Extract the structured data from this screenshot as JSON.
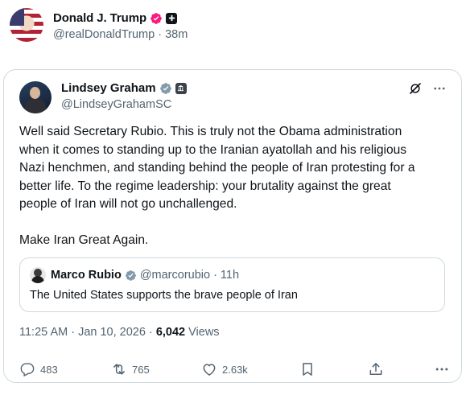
{
  "outer_post": {
    "author_name": "Donald J. Trump",
    "handle": "@realDonaldTrump",
    "separator": "·",
    "time_ago": "38m"
  },
  "quoted_post": {
    "author_name": "Lindsey Graham",
    "handle": "@LindseyGrahamSC",
    "text": "Well said Secretary Rubio. This is truly not the Obama administration\nwhen it comes to standing up to the Iranian ayatollah and his religious\nNazi henchmen, and standing behind the people of Iran protesting for a\nbetter life. To the regime leadership: your brutality against the great\npeople of Iran will not go unchallenged.\n\nMake Iran Great Again.",
    "nested_quote": {
      "author_name": "Marco Rubio",
      "handle": "@marcorubio",
      "separator": "·",
      "time_ago": "11h",
      "text": "The United States supports the brave people of Iran"
    },
    "timestamp": "11:25 AM · Jan 10, 2026 · ",
    "views_count": "6,042",
    "views_label": " Views",
    "actions": {
      "replies": "483",
      "reposts": "765",
      "likes": "2.63k"
    }
  },
  "colors": {
    "verified_blue": "#1d9bf0",
    "verified_pink": "#f9197f",
    "text_primary": "#0f1419",
    "text_secondary": "#536471",
    "border": "#cfd9de"
  },
  "icons": [
    "verified-badge-icon",
    "org-badge-icon",
    "grok-icon",
    "more-icon",
    "reply-icon",
    "repost-icon",
    "like-icon",
    "bookmark-icon",
    "share-icon"
  ]
}
